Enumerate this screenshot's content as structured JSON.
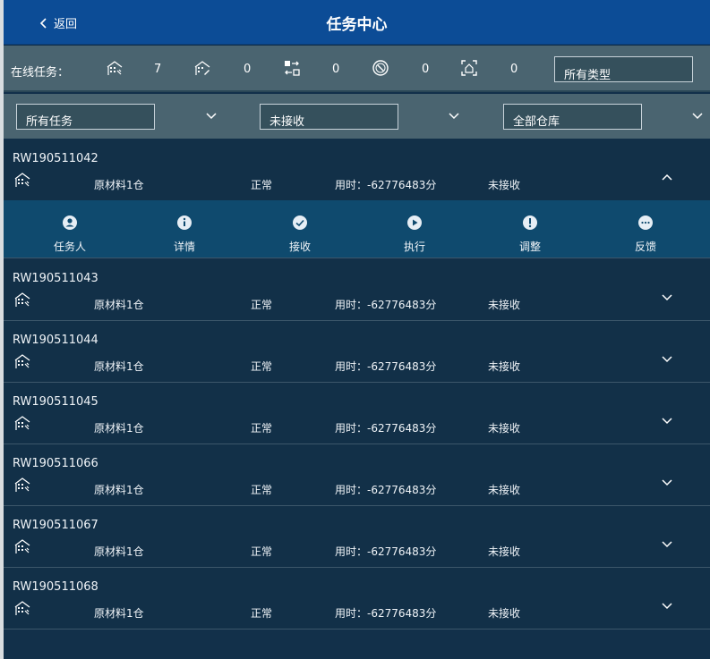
{
  "header": {
    "back_label": "返回",
    "title": "任务中心"
  },
  "stats": {
    "label": "在线任务：",
    "items": [
      {
        "icon": "warehouse-icon",
        "value": "7"
      },
      {
        "icon": "warehouse-edit-icon",
        "value": "0"
      },
      {
        "icon": "transfer-icon",
        "value": "0"
      },
      {
        "icon": "cancelled-icon",
        "value": "0"
      },
      {
        "icon": "scan-icon",
        "value": "0"
      }
    ],
    "type_filter": "所有类型"
  },
  "filters": {
    "task": "所有任务",
    "status": "未接收",
    "warehouse": "全部仓库"
  },
  "tasks": [
    {
      "code": "RW190511042",
      "material": "原材料1仓",
      "state": "正常",
      "time": "用时：-62776483分",
      "status": "未接收"
    },
    {
      "code": "RW190511043",
      "material": "原材料1仓",
      "state": "正常",
      "time": "用时：-62776483分",
      "status": "未接收"
    },
    {
      "code": "RW190511044",
      "material": "原材料1仓",
      "state": "正常",
      "time": "用时：-62776483分",
      "status": "未接收"
    },
    {
      "code": "RW190511045",
      "material": "原材料1仓",
      "state": "正常",
      "time": "用时：-62776483分",
      "status": "未接收"
    },
    {
      "code": "RW190511066",
      "material": "原材料1仓",
      "state": "正常",
      "time": "用时：-62776483分",
      "status": "未接收"
    },
    {
      "code": "RW190511067",
      "material": "原材料1仓",
      "state": "正常",
      "time": "用时：-62776483分",
      "status": "未接收"
    },
    {
      "code": "RW190511068",
      "material": "原材料1仓",
      "state": "正常",
      "time": "用时：-62776483分",
      "status": "未接收"
    }
  ],
  "actions": [
    {
      "label": "任务人",
      "icon": "person-icon"
    },
    {
      "label": "详情",
      "icon": "info-icon"
    },
    {
      "label": "接收",
      "icon": "check-icon"
    },
    {
      "label": "执行",
      "icon": "play-icon"
    },
    {
      "label": "调整",
      "icon": "alert-icon"
    },
    {
      "label": "反馈",
      "icon": "chat-icon"
    }
  ],
  "colors": {
    "header": "#0c4c96",
    "panel": "#4a6470",
    "row": "#123048",
    "action_bar": "#0f4a6e"
  }
}
